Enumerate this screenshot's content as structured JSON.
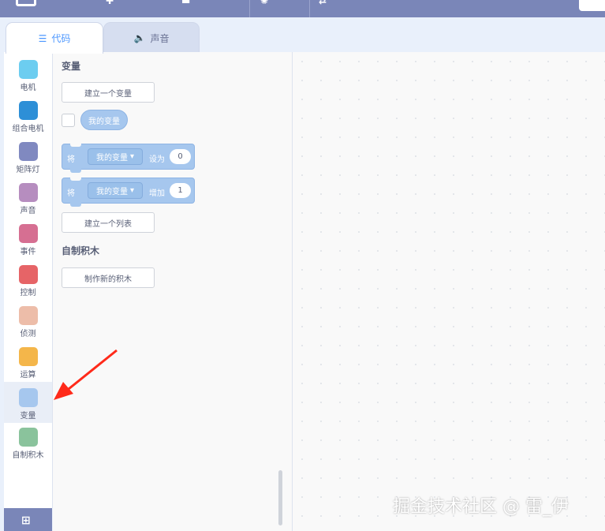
{
  "editor": {
    "tabs": [
      {
        "label": "代码",
        "icon": "code-icon",
        "active": true
      },
      {
        "label": "声音",
        "icon": "speaker-icon",
        "active": false
      }
    ]
  },
  "categories": [
    {
      "label": "电机",
      "color": "#6ccdf0"
    },
    {
      "label": "组合电机",
      "color": "#2d8fd7"
    },
    {
      "label": "矩阵灯",
      "color": "#8089c0"
    },
    {
      "label": "声音",
      "color": "#b68dbf"
    },
    {
      "label": "事件",
      "color": "#d66f92"
    },
    {
      "label": "控制",
      "color": "#e66467"
    },
    {
      "label": "侦测",
      "color": "#edbda9"
    },
    {
      "label": "运算",
      "color": "#f4b64a"
    },
    {
      "label": "变量",
      "color": "#a6c7ee",
      "selected": true
    },
    {
      "label": "自制积木",
      "color": "#8ac39c"
    }
  ],
  "palette": {
    "variables_heading": "变量",
    "make_variable": "建立一个变量",
    "my_variable": "我的变量",
    "set_block": {
      "word1": "将",
      "variable": "我的变量",
      "word2": "设为",
      "value": "0"
    },
    "change_block": {
      "word1": "将",
      "variable": "我的变量",
      "word2": "增加",
      "value": "1"
    },
    "make_list": "建立一个列表",
    "my_blocks_heading": "自制积木",
    "make_block": "制作新的积木"
  },
  "watermark": "掘金技术社区 @ 雷_伊",
  "annotation": {
    "color": "#ff2a1a",
    "points_to": "变量"
  }
}
